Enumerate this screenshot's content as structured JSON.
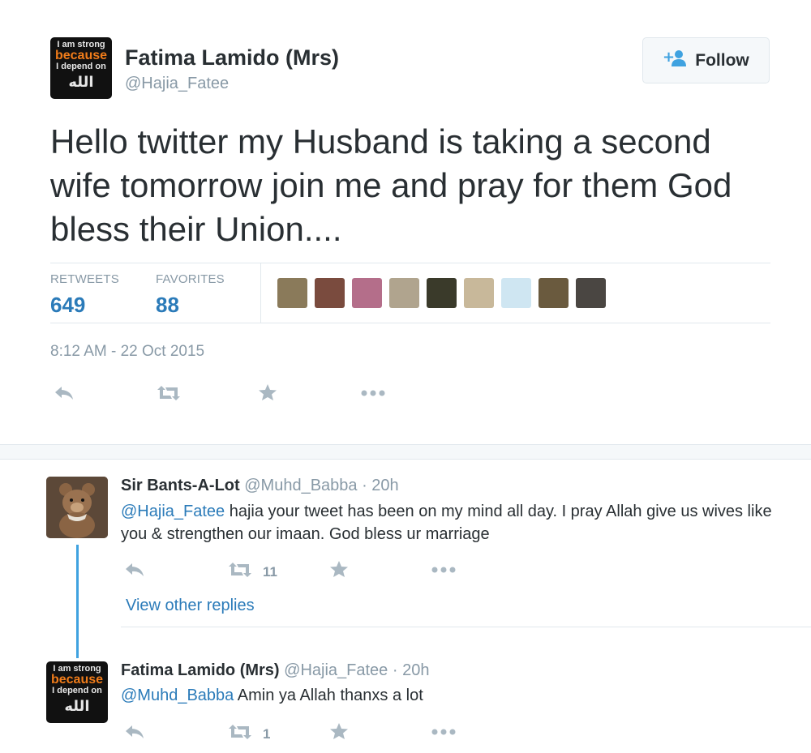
{
  "main_tweet": {
    "avatar_text": [
      "I am strong",
      "because",
      "I depend on",
      "الله"
    ],
    "name": "Fatima Lamido (Mrs)",
    "handle": "@Hajia_Fatee",
    "follow_label": "Follow",
    "text": "Hello twitter my Husband is taking a second wife tomorrow join me and pray for them God bless their Union....",
    "stats": {
      "retweets_label": "RETWEETS",
      "retweets_value": "649",
      "favorites_label": "FAVORITES",
      "favorites_value": "88"
    },
    "favoriter_colors": [
      "#8a7a5a",
      "#7a4b3e",
      "#b46e8a",
      "#b0a48e",
      "#3a3a2a",
      "#c8b89a",
      "#cfe6f2",
      "#6a5a3e",
      "#4a4642"
    ],
    "timestamp": "8:12 AM - 22 Oct 2015",
    "actions": [
      "reply-icon",
      "retweet-icon",
      "favorite-icon",
      "more-icon"
    ]
  },
  "replies": [
    {
      "name": "Sir Bants-A-Lot",
      "handle": "@Muhd_Babba",
      "time": "· 20h",
      "mention": "@Hajia_Fatee",
      "text": " hajia your tweet has been on my mind all day. I pray Allah give us wives like you & strengthen our imaan. God bless ur marriage",
      "retweet_count": "11"
    },
    {
      "name": "Fatima Lamido (Mrs)",
      "handle": "@Hajia_Fatee",
      "time": "· 20h",
      "mention": "@Muhd_Babba",
      "text": " Amin ya Allah thanxs a lot",
      "retweet_count": "1"
    }
  ],
  "view_other_replies": "View other replies",
  "colors": {
    "link": "#2b7bb9",
    "muted": "#8899a6",
    "thread": "#3fa2e0",
    "avatar_orange": "#f07c1a"
  }
}
